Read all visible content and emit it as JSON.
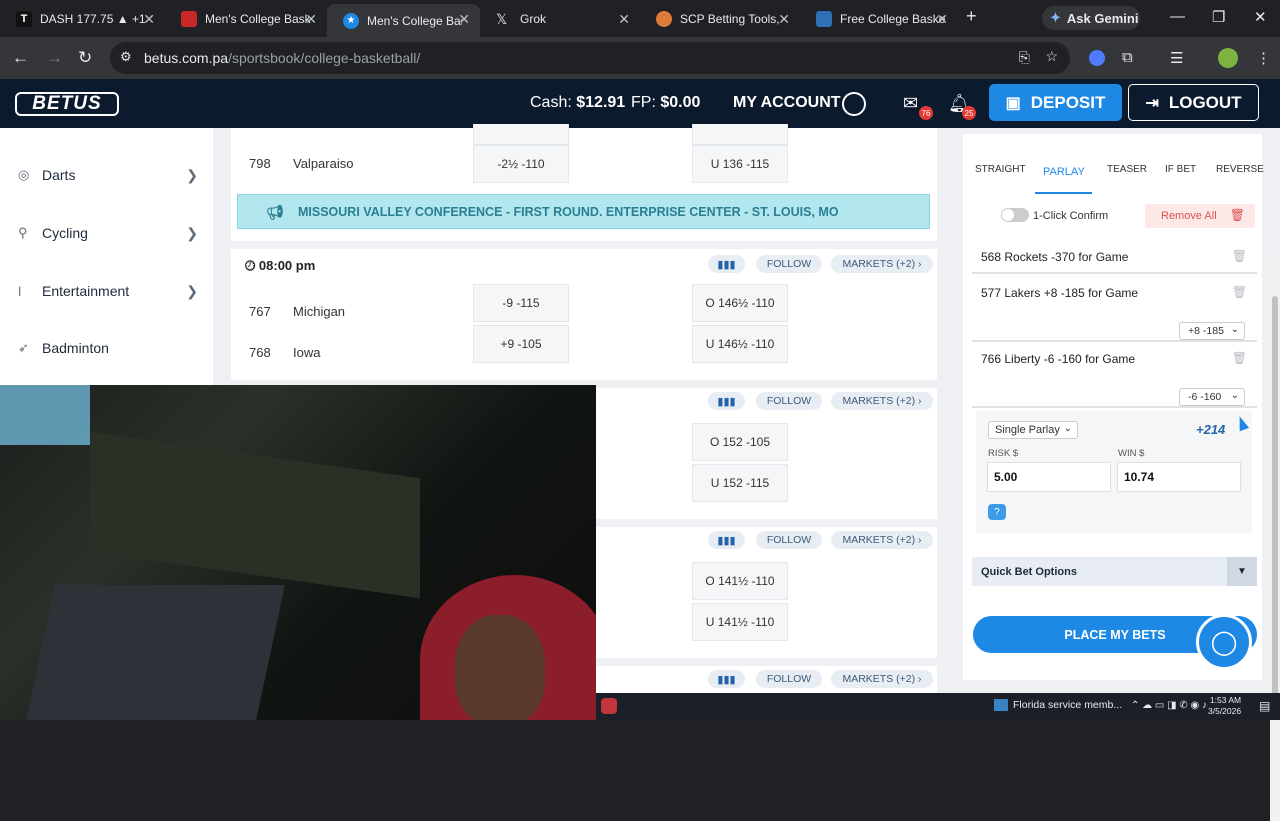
{
  "browser": {
    "tabs": [
      {
        "title": "DASH 177.75 ▲ +1",
        "fav": "#1a1a1a"
      },
      {
        "title": "Men's College Bask",
        "fav": "#c62828"
      },
      {
        "title": "Men's College Bask",
        "fav": "#1e88e5"
      },
      {
        "title": "Grok",
        "fav": "#e8eaed"
      },
      {
        "title": "SCP Betting Tools, ",
        "fav": "#e07a3a"
      },
      {
        "title": "Free College Baske",
        "fav": "#2f6fb5"
      }
    ],
    "gemini": "Ask Gemini",
    "url_host": "betus.com.pa",
    "url_path": "/sportsbook/college-basketball/"
  },
  "site": {
    "logo": "BETUS",
    "cash_label": "Cash:",
    "cash_value": "$12.91",
    "fp_label": "FP:",
    "fp_value": "$0.00",
    "my_account": "MY ACCOUNT",
    "mail_badge": "76",
    "bell_badge": "25",
    "deposit": "DEPOSIT",
    "logout": "LOGOUT"
  },
  "leftnav": [
    {
      "label": "Darts",
      "icon": "darts-icon"
    },
    {
      "label": "Cycling",
      "icon": "cycling-icon"
    },
    {
      "label": "Entertainment",
      "icon": "entertainment-icon"
    },
    {
      "label": "Badminton",
      "icon": "badminton-icon"
    }
  ],
  "games": {
    "top_row": {
      "rot": "798",
      "team": "Valparaiso",
      "spread": "-2½ -110",
      "total": "U 136 -115"
    },
    "conference": "MISSOURI VALLEY CONFERENCE - FIRST ROUND. ENTERPRISE CENTER - ST. LOUIS, MO",
    "game1": {
      "time": "08:00 pm",
      "rows": [
        {
          "rot": "767",
          "team": "Michigan",
          "spread": "-9 -115",
          "total": "O 146½ -110"
        },
        {
          "rot": "768",
          "team": "Iowa",
          "spread": "+9 -105",
          "total": "U 146½ -110"
        }
      ]
    },
    "game2": {
      "o": "O 152 -105",
      "u": "U 152 -115"
    },
    "game3": {
      "o": "O 141½ -110",
      "u": "U 141½ -110"
    },
    "follow": "FOLLOW",
    "markets": "MARKETS (+2)"
  },
  "betslip": {
    "tabs": [
      "STRAIGHT",
      "PARLAY",
      "TEASER",
      "IF BET",
      "REVERSE"
    ],
    "one_click": "1-Click Confirm",
    "remove_all": "Remove All",
    "picks": [
      {
        "label": "568 Rockets -370 for Game",
        "select": ""
      },
      {
        "label": "577 Lakers +8 -185 for Game",
        "select": "+8 -185"
      },
      {
        "label": "766 Liberty -6 -160 for Game",
        "select": "-6 -160"
      }
    ],
    "parlay_type": "Single Parlay",
    "odds": "+214",
    "risk_label": "RISK $",
    "risk_value": "5.00",
    "win_label": "WIN $",
    "win_value": "10.74",
    "quick_bet": "Quick Bet Options",
    "place": "PLACE MY BETS"
  },
  "taskbar": {
    "notification": "Florida service memb...",
    "time": "1:53 AM",
    "date": "3/5/2026"
  }
}
